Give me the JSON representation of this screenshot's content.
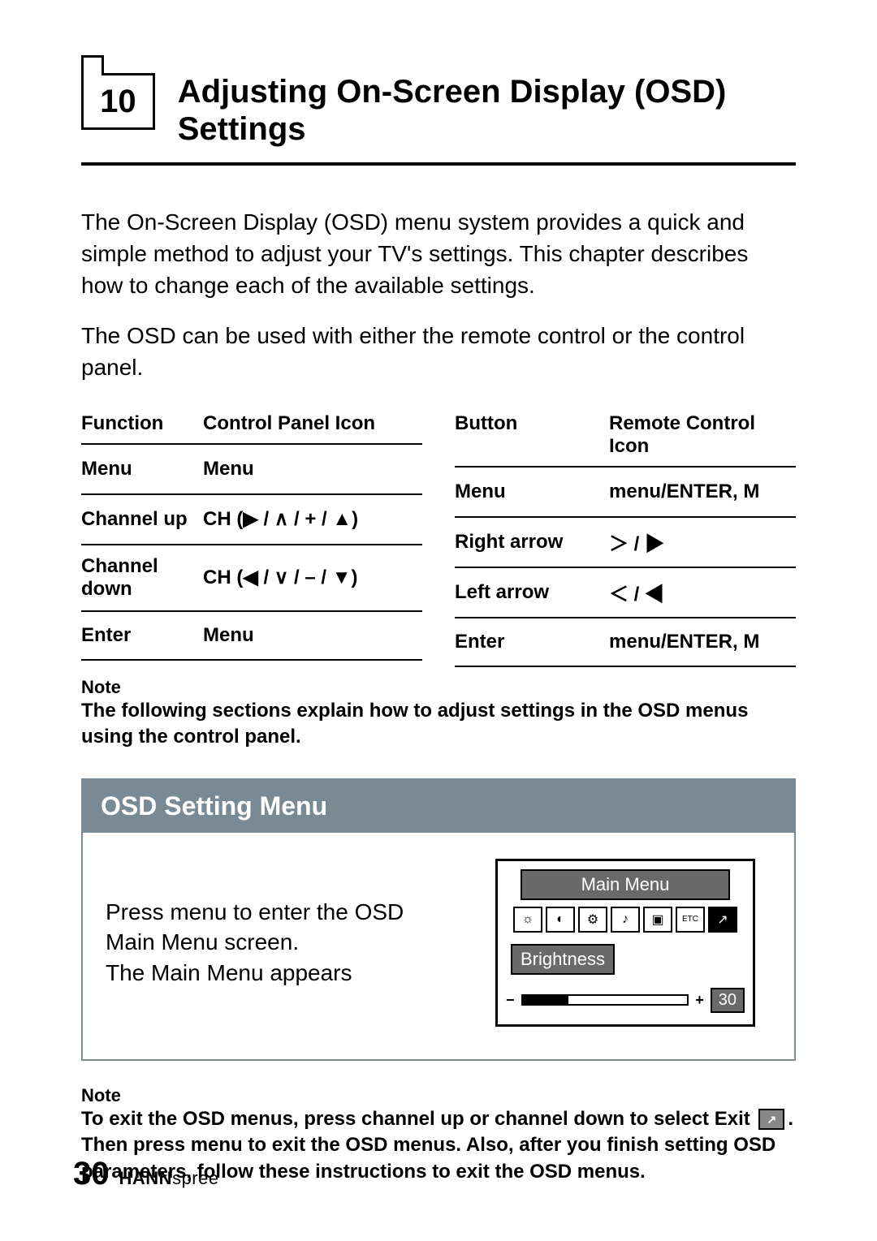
{
  "chapter": {
    "number": "10",
    "title": "Adjusting On-Screen Display (OSD) Settings"
  },
  "paragraphs": {
    "p1": "The On-Screen Display (OSD) menu system provides a quick and simple method to adjust your TV's settings. This chapter describes how to change each of the available settings.",
    "p2": "The OSD can be used with either the remote control or the control panel."
  },
  "table": {
    "headers": {
      "function": "Function",
      "panel_icon": "Control Panel Icon",
      "button": "Button",
      "remote_icon": "Remote Control Icon"
    },
    "rows": [
      {
        "function": "Menu",
        "panel_icon": "Menu",
        "button": "Menu",
        "remote_icon": "menu/ENTER, M"
      },
      {
        "function": "Channel up",
        "panel_icon": "CH (▶ / ∧ / + / ▲)",
        "button": "Right arrow",
        "remote_icon": "＞ / ▶"
      },
      {
        "function": "Channel down",
        "panel_icon": "CH (◀ / ∨ / – / ▼)",
        "button": "Left arrow",
        "remote_icon": "＜ / ◀"
      },
      {
        "function": "Enter",
        "panel_icon": "Menu",
        "button": "Enter",
        "remote_icon": "menu/ENTER, M"
      }
    ]
  },
  "note1": {
    "label": "Note",
    "text": "The following sections explain how to adjust settings in the OSD menus using the control panel."
  },
  "osd_box": {
    "title": "OSD Setting Menu",
    "instruction": "Press menu to enter the OSD Main Menu screen.\nThe Main Menu appears",
    "screen": {
      "title": "Main  Menu",
      "icons": [
        "☼",
        "◐",
        "⚙",
        "♪",
        "▣",
        "ETC",
        "↗"
      ],
      "setting_label": "Brightness",
      "slider_value": "30"
    }
  },
  "note2": {
    "label": "Note",
    "text_a": "To exit the OSD menus, press channel up or channel down to select Exit ",
    "text_b": ". Then press menu to exit the OSD menus. Also, after you finish setting OSD parameters, follow these instructions to exit the OSD menus."
  },
  "footer": {
    "page": "30",
    "brand_bold": "HANN",
    "brand_rest": "spree"
  }
}
